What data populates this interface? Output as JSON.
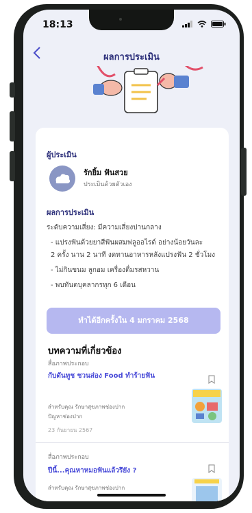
{
  "status": {
    "time": "18:13"
  },
  "header": {
    "title": "ผลการประเมิน"
  },
  "assessor": {
    "section_title": "ผู้ประเมิน",
    "name": "รักยิ้ม ฟันสวย",
    "subtitle": "ประเมินด้วยตัวเอง"
  },
  "result": {
    "section_title": "ผลการประเมิน",
    "risk_line": "ระดับความเสี่ยง: มีความเสี่ยงปานกลาง",
    "advice": [
      "- แปรงฟันด้วยยาสีฟันผสมฟลูออไรด์ อย่างน้อยวันละ",
      "2 ครั้ง นาน 2 นาที งดทานอาหารหลังแปรงฟัน 2 ชั่วโมง",
      "- ไม่กินขนม ลูกอม เครื่องดื่มรสหวาน",
      "- พบทันตบุคลากรทุก 6 เดือน"
    ]
  },
  "retry_button": "ทำได้อีกครั้งใน 4 มกราคม 2568",
  "articles": {
    "heading": "บทความที่เกี่ยวข้อง",
    "items": [
      {
        "category": "สื่อภาพประกอบ",
        "title": "กับดันทูช ชวนส่อง Food ทำร้ายฟัน",
        "audience": "สำหรับคุณ  รักษาสุขภาพช่องปาก",
        "topic": "ปัญหาช่องปาก",
        "date": "23 กันยายน 2567"
      },
      {
        "category": "สื่อภาพประกอบ",
        "title": "ปีนี้...คุณหาหมอฟันแล้วรึยัง ?",
        "audience": "สำหรับคุณ  รักษาสุขภาพช่องปาก"
      }
    ]
  },
  "colors": {
    "accent": "#4a4cd8",
    "title": "#2c2f7a",
    "button": "#b6b8f0",
    "background": "#eef0f8"
  }
}
